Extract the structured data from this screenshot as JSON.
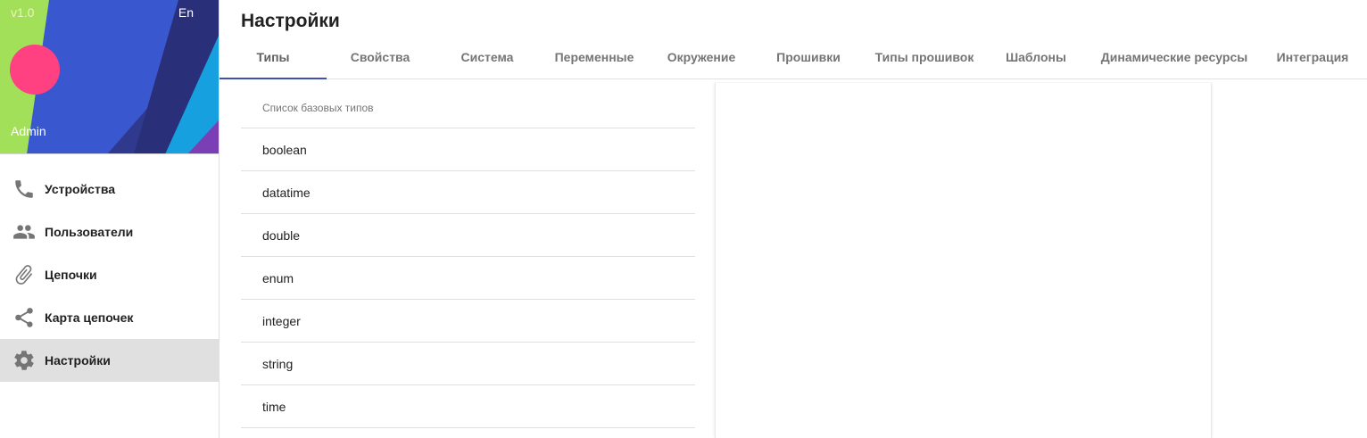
{
  "sidebar": {
    "version": "v1.0",
    "lang": "En",
    "username": "Admin",
    "items": [
      {
        "label": "Устройства",
        "icon": "phone-icon"
      },
      {
        "label": "Пользователи",
        "icon": "people-icon"
      },
      {
        "label": "Цепочки",
        "icon": "paperclip-icon"
      },
      {
        "label": "Карта цепочек",
        "icon": "share-icon"
      },
      {
        "label": "Настройки",
        "icon": "gear-icon",
        "active": true
      }
    ],
    "avatar_color": "#ff4081"
  },
  "main": {
    "title": "Настройки",
    "tabs": [
      {
        "label": "Типы",
        "active": true
      },
      {
        "label": "Свойства"
      },
      {
        "label": "Система"
      },
      {
        "label": "Переменные"
      },
      {
        "label": "Окружение"
      },
      {
        "label": "Прошивки"
      },
      {
        "label": "Типы прошивок"
      },
      {
        "label": "Шаблоны"
      },
      {
        "label": "Динамические ресурсы"
      },
      {
        "label": "Интеграция"
      }
    ],
    "accent_color": "#3f51b5",
    "types_list": {
      "header": "Список базовых типов",
      "items": [
        "boolean",
        "datatime",
        "double",
        "enum",
        "integer",
        "string",
        "time"
      ]
    }
  }
}
